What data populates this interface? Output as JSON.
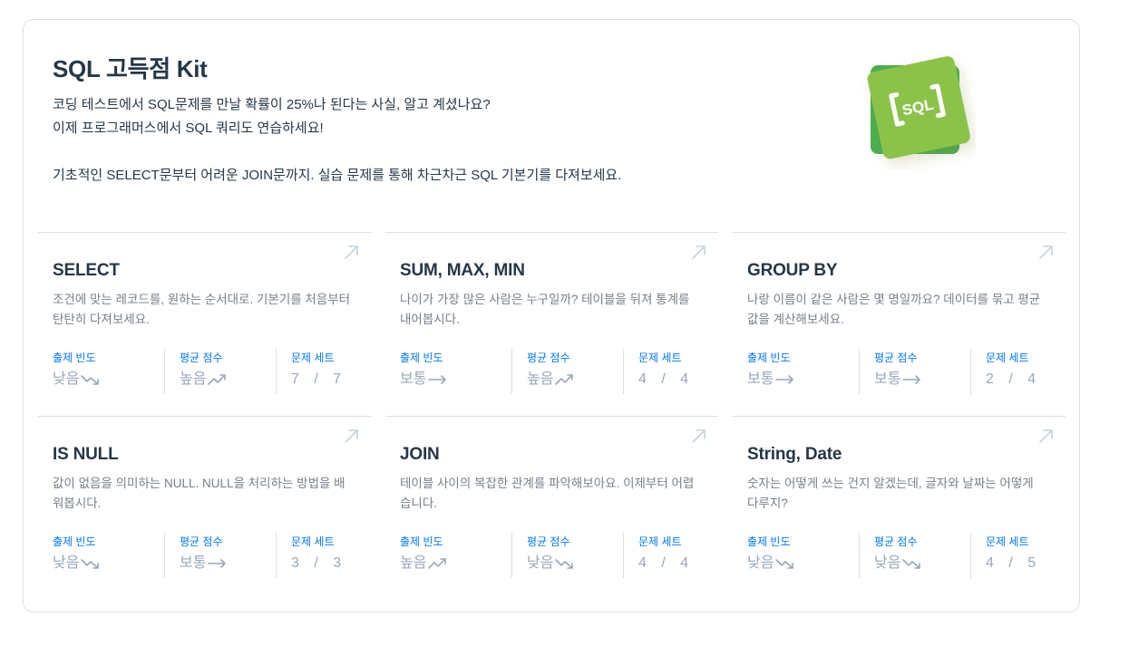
{
  "kit": {
    "title": "SQL 고득점 Kit",
    "desc_line1": "코딩 테스트에서 SQL문제를 만날 확률이 25%나 된다는 사실, 알고 계셨나요?",
    "desc_line2": "이제 프로그래머스에서 SQL 쿼리도 연습하세요!",
    "desc_line3": "기초적인 SELECT문부터 어려운 JOIN문까지. 실습 문제를 통해 차근차근 SQL 기본기를 다져보세요.",
    "logo_text": "SQL",
    "logo_icon": "sql-logo-icon"
  },
  "stat_labels": {
    "frequency": "출제 빈도",
    "score": "평균 점수",
    "set": "문제 세트"
  },
  "colors": {
    "accent": "#0078ff",
    "title": "#263747",
    "muted": "#98a8b9",
    "green": "#8bc34a",
    "green_dark": "#4caf50"
  },
  "cards": [
    {
      "title": "SELECT",
      "desc": "조건에 맞는 레코드를, 원하는 순서대로. 기본기를 처음부터 탄탄히 다져보세요.",
      "frequency": "낮음",
      "frequency_trend": "down",
      "score": "높음",
      "score_trend": "up",
      "set": "7 / 7"
    },
    {
      "title": "SUM, MAX, MIN",
      "desc": "나이가 가장 많은 사람은 누구일까? 테이블을 뒤져 통계를 내어봅시다.",
      "frequency": "보통",
      "frequency_trend": "flat",
      "score": "높음",
      "score_trend": "up",
      "set": "4 / 4"
    },
    {
      "title": "GROUP BY",
      "desc": "나랑 이름이 같은 사람은 몇 명일까요? 데이터를 묶고 평균값을 계산해보세요.",
      "frequency": "보통",
      "frequency_trend": "flat",
      "score": "보통",
      "score_trend": "flat",
      "set": "2 / 4"
    },
    {
      "title": "IS NULL",
      "desc": "값이 없음을 의미하는 NULL. NULL을 처리하는 방법을 배워봅시다.",
      "frequency": "낮음",
      "frequency_trend": "down",
      "score": "보통",
      "score_trend": "flat",
      "set": "3 / 3"
    },
    {
      "title": "JOIN",
      "desc": "테이블 사이의 복잡한 관계를 파악해보아요. 이제부터 어렵습니다.",
      "frequency": "높음",
      "frequency_trend": "up",
      "score": "낮음",
      "score_trend": "down",
      "set": "4 / 4"
    },
    {
      "title": "String, Date",
      "desc": "숫자는 어떻게 쓰는 건지 알겠는데, 글자와 날짜는 어떻게 다루지?",
      "frequency": "낮음",
      "frequency_trend": "down",
      "score": "낮음",
      "score_trend": "down",
      "set": "4 / 5"
    }
  ]
}
